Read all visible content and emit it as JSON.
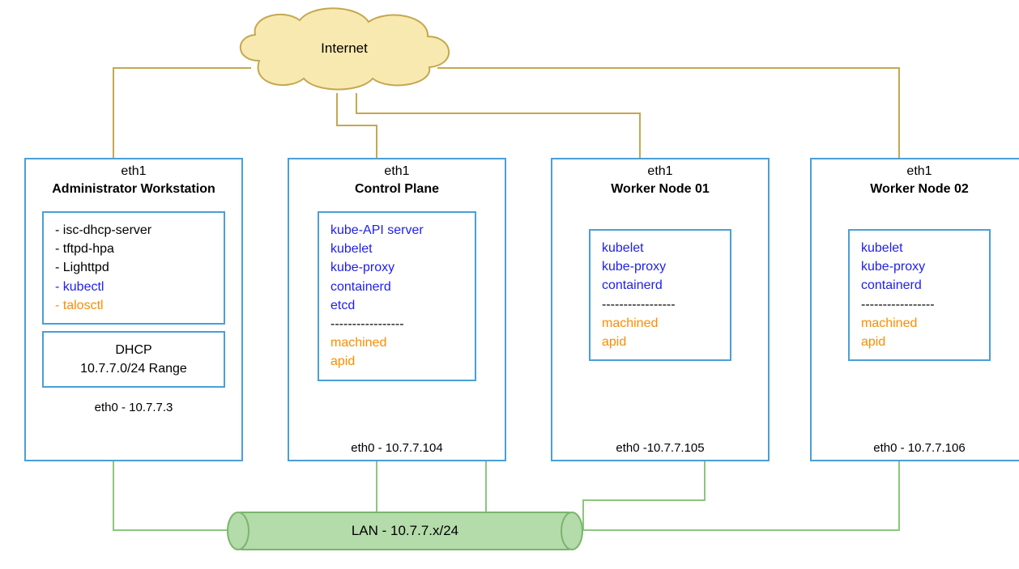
{
  "internet_label": "Internet",
  "lan_label": "LAN - 10.7.7.x/24",
  "nodes": {
    "admin": {
      "eth1": "eth1",
      "title": "Administrator Workstation",
      "services_black_1": "- isc-dhcp-server",
      "services_black_2": "- tftpd-hpa",
      "services_black_3": "- Lighttpd",
      "services_blue_1": "- kubectl",
      "services_orange_1": "- talosctl",
      "dhcp_1": "DHCP",
      "dhcp_2": "10.7.7.0/24 Range",
      "eth0": "eth0 - 10.7.7.3"
    },
    "control": {
      "eth1": "eth1",
      "title": "Control Plane",
      "svc_b1": "kube-API server",
      "svc_b2": "kubelet",
      "svc_b3": "kube-proxy",
      "svc_b4": "containerd",
      "svc_b5": "etcd",
      "sep": "-----------------",
      "svc_o1": "machined",
      "svc_o2": "apid",
      "eth0": "eth0 - 10.7.7.104"
    },
    "worker1": {
      "eth1": "eth1",
      "title": "Worker Node 01",
      "svc_b1": "kubelet",
      "svc_b2": "kube-proxy",
      "svc_b3": "containerd",
      "sep": "-----------------",
      "svc_o1": "machined",
      "svc_o2": "apid",
      "eth0": "eth0 -10.7.7.105"
    },
    "worker2": {
      "eth1": "eth1",
      "title": "Worker Node 02",
      "svc_b1": "kubelet",
      "svc_b2": "kube-proxy",
      "svc_b3": "containerd",
      "sep": "-----------------",
      "svc_o1": "machined",
      "svc_o2": "apid",
      "eth0": "eth0 - 10.7.7.106"
    }
  }
}
